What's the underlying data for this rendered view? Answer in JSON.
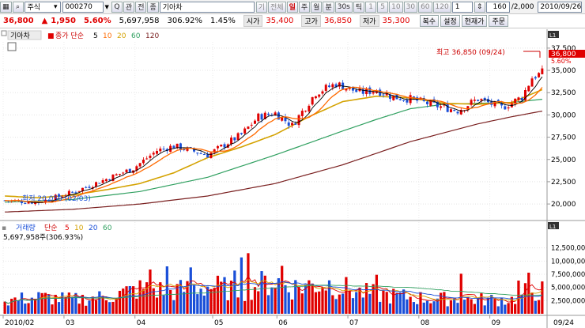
{
  "toolbar": {
    "icons": [
      "grid-icon",
      "search-icon",
      "chart-icon",
      "window-icon"
    ],
    "market_select": "주식",
    "code_value": "000270",
    "small_buttons": [
      "Q",
      "관",
      "전",
      "종",
      "기아차"
    ],
    "periods": [
      "기",
      "전체",
      "일",
      "주",
      "월",
      "분",
      "30s",
      "틱",
      "1",
      "5",
      "10",
      "30",
      "60",
      "120"
    ],
    "spin_value": "1",
    "count_value": "160",
    "count_total": "/2,000",
    "date_value": "2010/09/26"
  },
  "quote": {
    "price": "36,800",
    "change": "1,950",
    "change_pct": "5.60%",
    "volume": "5,697,958",
    "vol_ratio": "306.92%",
    "turnover": "1.45%",
    "open_label": "시가",
    "open": "35,400",
    "high_label": "고가",
    "high": "36,850",
    "low_label": "저가",
    "low": "35,300",
    "buttons": [
      "복수",
      "설정",
      "현재가",
      "주문"
    ]
  },
  "colors": {
    "up": "#e00000",
    "down": "#1a4fd8",
    "ma5": "#000000",
    "ma10": "#ff6a00",
    "ma20": "#d4a200",
    "ma60": "#30a060",
    "ma120": "#7a2020"
  },
  "chart_data": {
    "type": "candlestick",
    "price_panel": {
      "title": "기아차",
      "ma_legend": {
        "label": "종가 단순",
        "periods": [
          "5",
          "10",
          "20",
          "60",
          "120"
        ]
      },
      "yticks": [
        "37,500",
        "35,000",
        "32,500",
        "30,000",
        "27,500",
        "25,000",
        "22,500",
        "20,000"
      ],
      "ylim": [
        18500,
        38200
      ],
      "current_price_tag": "36,800",
      "current_pct_tag": "5.60%",
      "annotations": {
        "high": "최고 36,850 (09/24)",
        "low": "최저 20,050 (02/03)"
      },
      "ma_series": {
        "ma20": [
          [
            0,
            20900
          ],
          [
            10,
            20700
          ],
          [
            20,
            21000
          ],
          [
            30,
            21600
          ],
          [
            40,
            22300
          ],
          [
            50,
            23500
          ],
          [
            60,
            25200
          ],
          [
            70,
            26400
          ],
          [
            80,
            27800
          ],
          [
            90,
            29800
          ],
          [
            100,
            31500
          ],
          [
            110,
            32100
          ],
          [
            120,
            31900
          ],
          [
            130,
            31300
          ],
          [
            140,
            31200
          ],
          [
            150,
            31400
          ],
          [
            160,
            33000
          ]
        ],
        "ma60": [
          [
            0,
            20200
          ],
          [
            20,
            20500
          ],
          [
            40,
            21400
          ],
          [
            60,
            23000
          ],
          [
            80,
            25500
          ],
          [
            100,
            28200
          ],
          [
            110,
            29500
          ],
          [
            120,
            30700
          ],
          [
            130,
            31200
          ],
          [
            140,
            31300
          ],
          [
            150,
            31400
          ],
          [
            160,
            31800
          ]
        ],
        "ma120": [
          [
            0,
            19100
          ],
          [
            20,
            19400
          ],
          [
            40,
            20000
          ],
          [
            60,
            20900
          ],
          [
            80,
            22300
          ],
          [
            100,
            24400
          ],
          [
            120,
            27000
          ],
          [
            140,
            29000
          ],
          [
            150,
            29800
          ],
          [
            160,
            30500
          ]
        ]
      },
      "candle_anchors": [
        [
          0,
          20400
        ],
        [
          10,
          20200
        ],
        [
          20,
          21300
        ],
        [
          30,
          22800
        ],
        [
          38,
          24000
        ],
        [
          45,
          26000
        ],
        [
          50,
          26500
        ],
        [
          60,
          25500
        ],
        [
          70,
          27800
        ],
        [
          75,
          29800
        ],
        [
          80,
          30200
        ],
        [
          85,
          28800
        ],
        [
          92,
          32500
        ],
        [
          98,
          33500
        ],
        [
          105,
          32500
        ],
        [
          110,
          32800
        ],
        [
          115,
          32000
        ],
        [
          120,
          31800
        ],
        [
          128,
          31000
        ],
        [
          134,
          30500
        ],
        [
          140,
          31800
        ],
        [
          147,
          30800
        ],
        [
          153,
          32000
        ],
        [
          156,
          34200
        ],
        [
          160,
          34900
        ]
      ]
    },
    "volume_panel": {
      "title": "거래량",
      "ma_legend": {
        "label": "단순",
        "periods": [
          "5",
          "10",
          "20",
          "60"
        ]
      },
      "current_label": "5,697,958주(306.93%)",
      "yticks": [
        "12,500,000",
        "10,000,000",
        "7,500,000",
        "5,000,000",
        "2,500,000"
      ],
      "ylim": [
        0,
        13500000
      ],
      "volume_anchors": [
        [
          0,
          2800000
        ],
        [
          10,
          3500000
        ],
        [
          20,
          3000000
        ],
        [
          30,
          3600000
        ],
        [
          40,
          5200000
        ],
        [
          50,
          4800000
        ],
        [
          60,
          5800000
        ],
        [
          70,
          5000000
        ],
        [
          80,
          7000000
        ],
        [
          85,
          5500000
        ],
        [
          95,
          6500000
        ],
        [
          105,
          4500000
        ],
        [
          115,
          3800000
        ],
        [
          125,
          3200000
        ],
        [
          140,
          3000000
        ],
        [
          150,
          3000000
        ],
        [
          155,
          4800000
        ],
        [
          160,
          4800000
        ]
      ],
      "spikes": [
        [
          43,
          8400000
        ],
        [
          48,
          9000000
        ],
        [
          55,
          8800000
        ],
        [
          68,
          8200000
        ],
        [
          70,
          10700000
        ],
        [
          72,
          11500000
        ],
        [
          82,
          9100000
        ],
        [
          110,
          7400000
        ],
        [
          135,
          7600000
        ],
        [
          152,
          6300000
        ],
        [
          155,
          7800000
        ],
        [
          160,
          5700000
        ]
      ]
    },
    "x_labels": [
      {
        "i": 0,
        "t": "2010/02"
      },
      {
        "i": 18,
        "t": "03"
      },
      {
        "i": 39,
        "t": "04"
      },
      {
        "i": 62,
        "t": "05"
      },
      {
        "i": 81,
        "t": "06"
      },
      {
        "i": 102,
        "t": "07"
      },
      {
        "i": 123,
        "t": "08"
      },
      {
        "i": 144,
        "t": "09"
      }
    ],
    "x_end_label": "09/24",
    "n_bars": 160
  }
}
